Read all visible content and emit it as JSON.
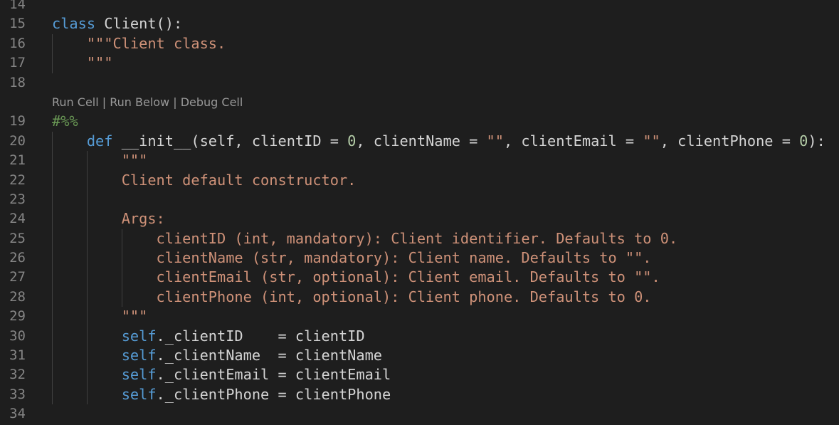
{
  "editor": {
    "codelens": {
      "items": [
        "Run Cell",
        "Run Below",
        "Debug Cell"
      ],
      "separator": " | "
    },
    "lines": [
      {
        "number": "14",
        "tokens": []
      },
      {
        "number": "15",
        "tokens": [
          [
            "class",
            "keyword"
          ],
          [
            " Client():",
            "plain"
          ]
        ]
      },
      {
        "number": "16",
        "tokens": [
          [
            "    ",
            "plain"
          ],
          [
            "\"\"\"Client class.",
            "string"
          ]
        ]
      },
      {
        "number": "17",
        "tokens": [
          [
            "    ",
            "plain"
          ],
          [
            "\"\"\"",
            "string"
          ]
        ]
      },
      {
        "number": "18",
        "tokens": []
      },
      {
        "number": "19",
        "tokens": [
          [
            "#%%",
            "comment"
          ]
        ],
        "codelens_before": true
      },
      {
        "number": "20",
        "tokens": [
          [
            "    ",
            "plain"
          ],
          [
            "def",
            "keyword"
          ],
          [
            " __init__(self, clientID = ",
            "plain"
          ],
          [
            "0",
            "number"
          ],
          [
            ", clientName = ",
            "plain"
          ],
          [
            "\"\"",
            "string"
          ],
          [
            ", clientEmail = ",
            "plain"
          ],
          [
            "\"\"",
            "string"
          ],
          [
            ", clientPhone = ",
            "plain"
          ],
          [
            "0",
            "number"
          ],
          [
            "):",
            "plain"
          ]
        ]
      },
      {
        "number": "21",
        "tokens": [
          [
            "        ",
            "plain"
          ],
          [
            "\"\"\"",
            "string"
          ]
        ]
      },
      {
        "number": "22",
        "tokens": [
          [
            "        ",
            "plain"
          ],
          [
            "Client default constructor.",
            "string"
          ]
        ]
      },
      {
        "number": "23",
        "tokens": []
      },
      {
        "number": "24",
        "tokens": [
          [
            "        ",
            "plain"
          ],
          [
            "Args:",
            "string"
          ]
        ]
      },
      {
        "number": "25",
        "tokens": [
          [
            "            ",
            "plain"
          ],
          [
            "clientID (int, mandatory): Client identifier. Defaults to 0.",
            "string"
          ]
        ]
      },
      {
        "number": "26",
        "tokens": [
          [
            "            ",
            "plain"
          ],
          [
            "clientName (str, mandatory): Client name. Defaults to \"\".",
            "string"
          ]
        ]
      },
      {
        "number": "27",
        "tokens": [
          [
            "            ",
            "plain"
          ],
          [
            "clientEmail (str, optional): Client email. Defaults to \"\".",
            "string"
          ]
        ]
      },
      {
        "number": "28",
        "tokens": [
          [
            "            ",
            "plain"
          ],
          [
            "clientPhone (int, optional): Client phone. Defaults to 0.",
            "string"
          ]
        ]
      },
      {
        "number": "29",
        "tokens": [
          [
            "        ",
            "plain"
          ],
          [
            "\"\"\"",
            "string"
          ]
        ]
      },
      {
        "number": "30",
        "tokens": [
          [
            "        ",
            "plain"
          ],
          [
            "self",
            "keyword"
          ],
          [
            "._clientID    = clientID",
            "plain"
          ]
        ]
      },
      {
        "number": "31",
        "tokens": [
          [
            "        ",
            "plain"
          ],
          [
            "self",
            "keyword"
          ],
          [
            "._clientName  = clientName",
            "plain"
          ]
        ]
      },
      {
        "number": "32",
        "tokens": [
          [
            "        ",
            "plain"
          ],
          [
            "self",
            "keyword"
          ],
          [
            "._clientEmail = clientEmail",
            "plain"
          ]
        ]
      },
      {
        "number": "33",
        "tokens": [
          [
            "        ",
            "plain"
          ],
          [
            "self",
            "keyword"
          ],
          [
            "._clientPhone = clientPhone",
            "plain"
          ]
        ]
      },
      {
        "number": "34",
        "tokens": []
      }
    ],
    "colors": {
      "background": "#1e1e1e",
      "keyword": "#569cd6",
      "string": "#ce9178",
      "number": "#b5cea8",
      "comment": "#6a9955",
      "text": "#d4d4d4",
      "line_number": "#858585"
    }
  }
}
